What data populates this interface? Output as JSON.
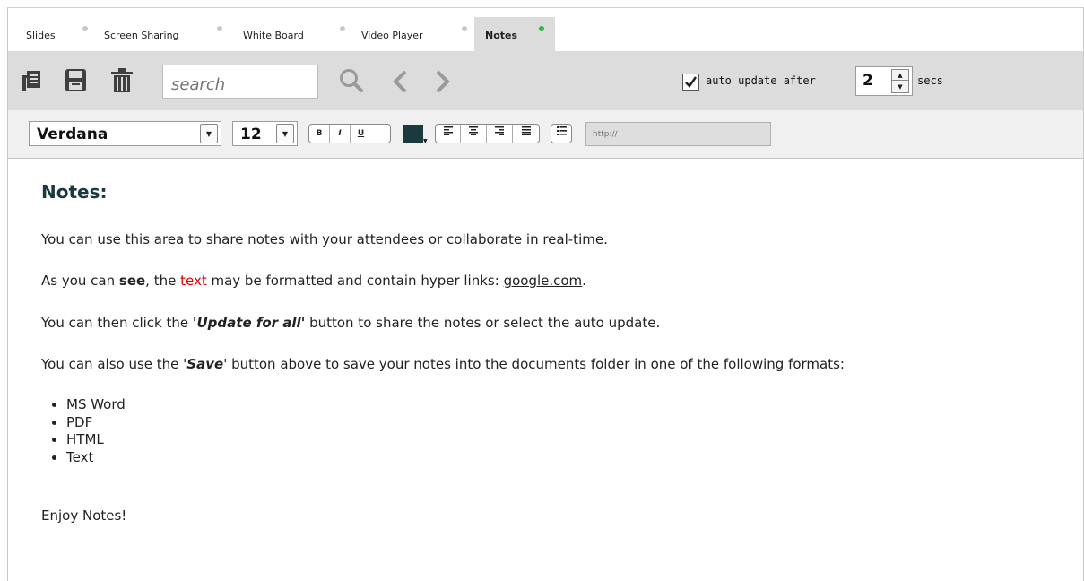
{
  "tabs": [
    {
      "label": "Slides",
      "active": false
    },
    {
      "label": "Screen Sharing",
      "active": false
    },
    {
      "label": "White Board",
      "active": false
    },
    {
      "label": "Video Player",
      "active": false
    },
    {
      "label": "Notes",
      "active": true
    }
  ],
  "toolbar": {
    "search_placeholder": "search",
    "auto_update_checked": true,
    "auto_update_label": "auto update after",
    "auto_update_value": "2",
    "secs_label": "secs",
    "icons": [
      "copy-icon",
      "save-icon",
      "delete-icon",
      "search-icon",
      "previous-icon",
      "next-icon"
    ]
  },
  "format_bar": {
    "font": "Verdana",
    "size": "12",
    "bold": "B",
    "italic": "I",
    "underline": "U",
    "color": "#1b3a40",
    "url_placeholder": "http://"
  },
  "content": {
    "title": "Notes:",
    "p1": "You can use this area to share notes with your attendees or collaborate in real-time.",
    "p2": {
      "a": "As you can ",
      "bold": "see",
      "b": ", the ",
      "red": "text",
      "c": " may be formatted and contain hyper links: ",
      "link": "google.com",
      "d": "."
    },
    "p3": {
      "a": "You can then click the ",
      "bold": "'Update for all'",
      "b": " button to share the notes or select the auto update."
    },
    "p4": {
      "a": "You can also use the '",
      "bold": "Save",
      "b": "' button above to save your notes into the documents folder in one of the following formats:"
    },
    "formats": [
      "MS Word",
      "PDF",
      "HTML",
      "Text"
    ],
    "closing": "Enjoy Notes!"
  }
}
